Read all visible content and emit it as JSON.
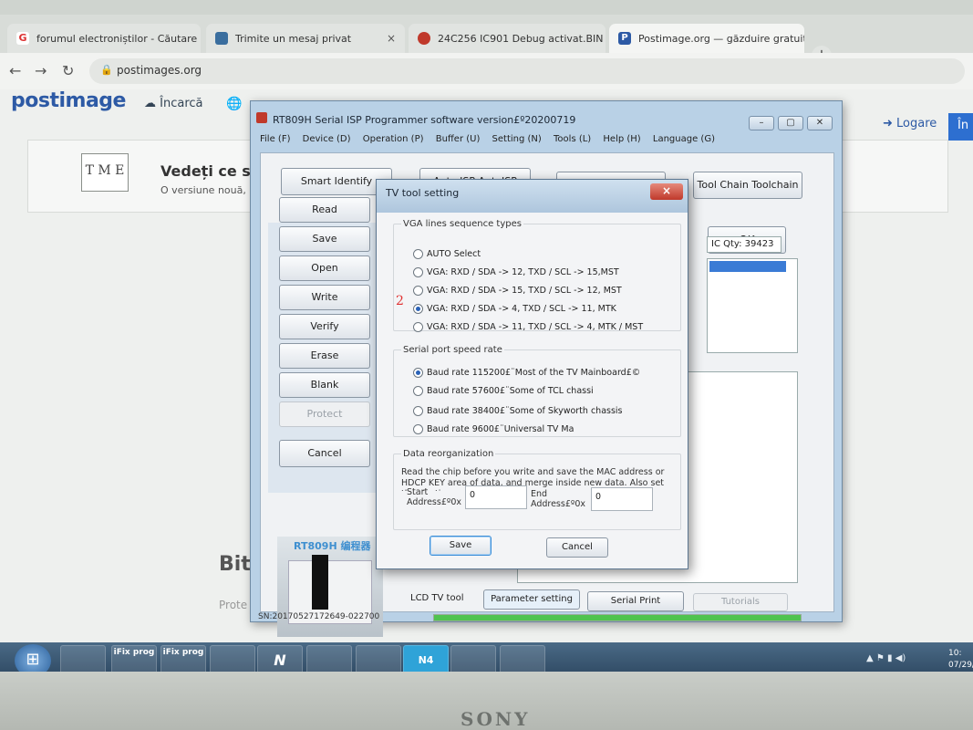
{
  "browser": {
    "tabs": [
      {
        "label": "forumul electroniștilor - Căutare ...",
        "favicon": "google",
        "active": false
      },
      {
        "label": "Trimite un mesaj privat",
        "favicon": "monitor",
        "active": false
      },
      {
        "label": "24C256 IC901 Debug activat.BIN",
        "favicon": "record",
        "active": false
      },
      {
        "label": "Postimage.org — găzduire gratuită",
        "favicon": "postimage",
        "active": true
      }
    ],
    "new_tab_label": "+",
    "close_glyph": "×",
    "url": "postimages.org"
  },
  "page": {
    "logo": "postimage",
    "upload_label": "Încarcă",
    "login_label": "Logare",
    "signup_label": "În",
    "card_title": "Vedeți ce s-a",
    "card_subtitle": "O versiune nouă, ",
    "bottom_heading": "Bit",
    "bottom_sub": "Prote"
  },
  "app": {
    "title": "RT809H Serial ISP Programmer software version£º20200719",
    "menu": [
      "File (F)",
      "Device (D)",
      "Operation (P)",
      "Buffer (U)",
      "Setting (N)",
      "Tools (L)",
      "Help (H)",
      "Language (G)"
    ],
    "toolbar": [
      "Smart Identify SmartID",
      "Auto ISP AutoISP",
      "Buffer Buffer",
      "Tool Chain Toolchain"
    ],
    "side_buttons": [
      "Read",
      "Save",
      "Open",
      "Write",
      "Verify",
      "Erase",
      "Blank",
      "Protect"
    ],
    "cancel_label": "Cancel",
    "ok_label": "OK",
    "ic_qty": "IC Qty: 39423",
    "device_label": "RT809H 编程器",
    "bottom_buttons": [
      "LCD TV tool",
      "Parameter setting",
      "Serial Print",
      "Tutorials"
    ],
    "serial_number": "SN:20170527172649-022700",
    "progress": 1.0
  },
  "dialog": {
    "title": "TV tool setting",
    "close_glyph": "×",
    "vga_group_title": "VGA lines sequence types",
    "vga_options": [
      {
        "label": "AUTO Select",
        "selected": false
      },
      {
        "label": "VGA: RXD / SDA -> 12, TXD / SCL -> 15,MST",
        "selected": false
      },
      {
        "label": "VGA: RXD / SDA -> 15, TXD / SCL -> 12, MST",
        "selected": false
      },
      {
        "label": "VGA: RXD / SDA ->  4, TXD / SCL -> 11, MTK",
        "selected": true
      },
      {
        "label": "VGA: RXD / SDA -> 11, TXD / SCL ->  4, MTK / MST",
        "selected": false
      }
    ],
    "marker": "2",
    "speed_group_title": "Serial port speed rate",
    "speed_options": [
      {
        "label": "Baud rate 115200£¨Most of the TV Mainboard£©",
        "selected": true
      },
      {
        "label": "Baud rate 57600£¨Some of TCL chassi",
        "selected": false
      },
      {
        "label": "Baud rate 38400£¨Some of Skyworth chassis",
        "selected": false
      },
      {
        "label": "Baud rate 9600£¨Universal TV Ma",
        "selected": false
      }
    ],
    "data_group_title": "Data reorganization",
    "data_description": "Read the chip before you write and save the MAC address or HDCP KEY area of data, and merge inside new data. Also set the starting",
    "start_label": "Start Address£º0x",
    "start_value": "0",
    "end_label": "End Address£º0x",
    "end_value": "0",
    "save_label": "Save",
    "cancel_label": "Cancel"
  },
  "taskbar": {
    "items": [
      "",
      "",
      "iFix prog",
      "iFix prog",
      "",
      "N",
      "",
      "",
      "N4",
      "",
      ""
    ],
    "clock_time": "10:",
    "clock_date": "07/29/"
  },
  "bezel_brand": "SONY"
}
